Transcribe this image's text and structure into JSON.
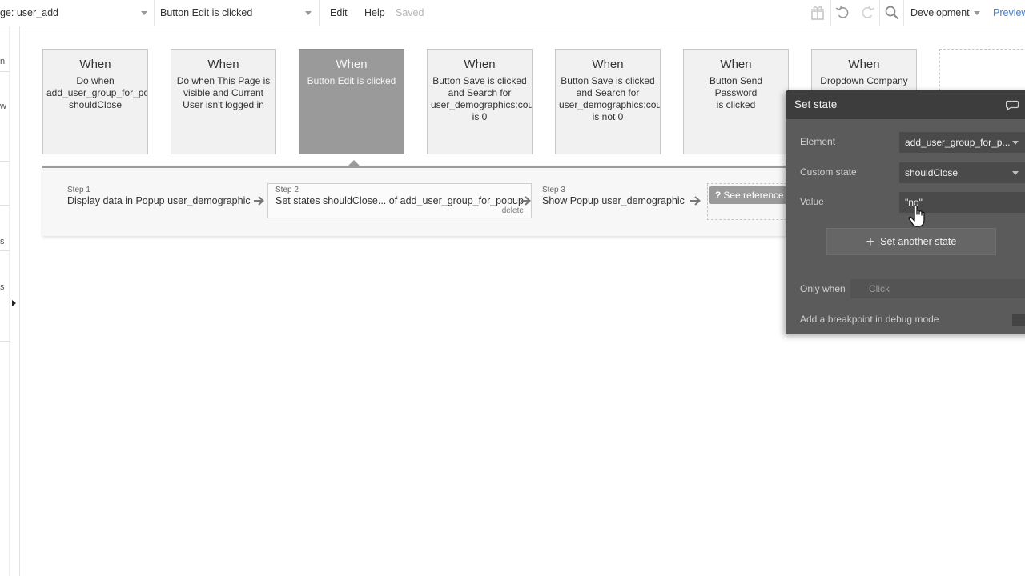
{
  "topbar": {
    "page_selector": "ge: user_add",
    "event_selector": "Button Edit is clicked",
    "menu_edit": "Edit",
    "menu_help": "Help",
    "saved_status": "Saved",
    "version_selector": "Development",
    "preview_link": "Preview",
    "icons": [
      "gift-icon",
      "undo-icon",
      "redo-icon",
      "search-icon"
    ]
  },
  "sidebar": {
    "fragments": [
      "n",
      "w",
      "s",
      "s"
    ]
  },
  "events": [
    {
      "when": "When",
      "desc": "Do when\nadd_user_group_for_po\nshouldClose"
    },
    {
      "when": "When",
      "desc": "Do when This Page is\nvisible and Current\nUser isn't logged in"
    },
    {
      "when": "When",
      "desc": "Button Edit is clicked"
    },
    {
      "when": "When",
      "desc": "Button Save is clicked\nand Search for\nuser_demographics:cou\nis 0"
    },
    {
      "when": "When",
      "desc": "Button Save is clicked\nand Search for\nuser_demographics:cou\nis not 0"
    },
    {
      "when": "When",
      "desc": "Button Send Password\nis clicked"
    },
    {
      "when": "When",
      "desc": "Dropdown Company"
    }
  ],
  "steps": [
    {
      "num": "Step 1",
      "text": "Display data in Popup user_demographic"
    },
    {
      "num": "Step 2",
      "text": "Set states shouldClose... of add_user_group_for_popup",
      "delete": "delete"
    },
    {
      "num": "Step 3",
      "text": "Show Popup user_demographic"
    }
  ],
  "see_reference": {
    "q": "?",
    "label": "See reference →"
  },
  "panel": {
    "title": "Set state",
    "element_label": "Element",
    "element_value": "add_user_group_for_p...",
    "custom_state_label": "Custom state",
    "custom_state_value": "shouldClose",
    "value_label": "Value",
    "value_value": "\"no\"",
    "add_button": "Set another state",
    "only_when_label": "Only when",
    "only_when_value": "Click",
    "debug_label": "Add a breakpoint in debug mode"
  },
  "colors": {
    "panel_bg": "#5b5b5b",
    "panel_header": "#3d3d3d",
    "active_card": "#9a9a9a",
    "link": "#3b7fd9"
  }
}
